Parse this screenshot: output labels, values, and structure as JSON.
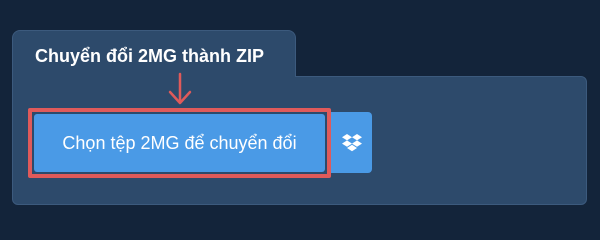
{
  "tab": {
    "title": "Chuyển đổi 2MG thành ZIP"
  },
  "upload": {
    "choose_label": "Chọn tệp 2MG để chuyển đổi",
    "dropbox_icon": "dropbox-icon"
  },
  "colors": {
    "background": "#13243a",
    "panel": "#2d4a6b",
    "button": "#4a9ae6",
    "highlight": "#e05a5a"
  }
}
